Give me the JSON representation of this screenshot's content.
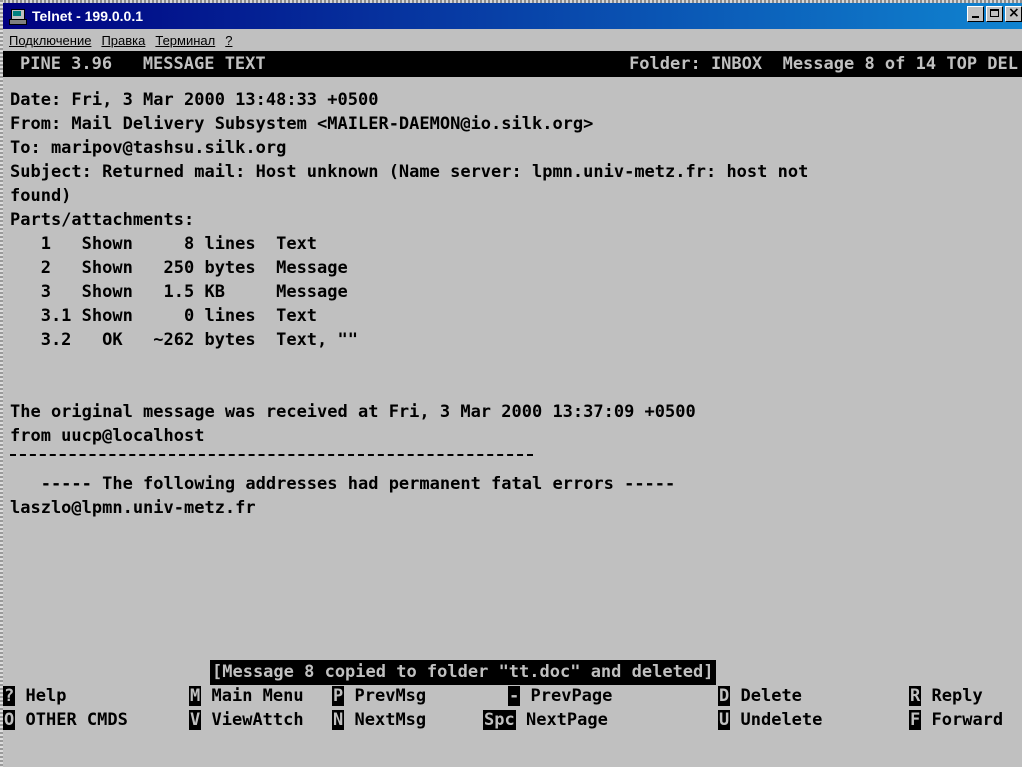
{
  "window": {
    "title": "Telnet - 199.0.0.1",
    "buttons": {
      "minimize": "_",
      "maximize": "□",
      "close": "×"
    }
  },
  "menu": {
    "items": [
      "Подключение",
      "Правка",
      "Терминал",
      "?"
    ]
  },
  "header": {
    "left": "PINE 3.96   MESSAGE TEXT",
    "right": "Folder: INBOX  Message 8 of 14 TOP DEL"
  },
  "message": {
    "lines": [
      "Date: Fri, 3 Mar 2000 13:48:33 +0500",
      "From: Mail Delivery Subsystem <MAILER-DAEMON@io.silk.org>",
      "To: maripov@tashsu.silk.org",
      "Subject: Returned mail: Host unknown (Name server: lpmn.univ-metz.fr: host not",
      "found)",
      "Parts/attachments:",
      "   1   Shown     8 lines  Text",
      "   2   Shown   250 bytes  Message",
      "   3   Shown   1.5 KB     Message",
      "   3.1 Shown     0 lines  Text",
      "   3.2   OK   ~262 bytes  Text, \"\""
    ],
    "body": [
      "The original message was received at Fri, 3 Mar 2000 13:37:09 +0500",
      "from uucp@localhost",
      "",
      "   ----- The following addresses had permanent fatal errors -----",
      "laszlo@lpmn.univ-metz.fr"
    ]
  },
  "status_message": "[Message 8 copied to folder \"tt.doc\" and deleted]",
  "commands": {
    "row1": [
      {
        "key": "?",
        "label": "Help"
      },
      {
        "key": "M",
        "label": "Main Menu"
      },
      {
        "key": "P",
        "label": "PrevMsg"
      },
      {
        "key": "-",
        "label": "PrevPage"
      },
      {
        "key": "D",
        "label": "Delete"
      },
      {
        "key": "R",
        "label": "Reply"
      }
    ],
    "row2": [
      {
        "key": "O",
        "label": "OTHER CMDS"
      },
      {
        "key": "V",
        "label": "ViewAttch"
      },
      {
        "key": "N",
        "label": "NextMsg"
      },
      {
        "key": "Spc",
        "label": "NextPage"
      },
      {
        "key": "U",
        "label": "Undelete"
      },
      {
        "key": "F",
        "label": "Forward"
      }
    ]
  },
  "colors": {
    "title_gradient_start": "#000080",
    "title_gradient_end": "#1084d0",
    "terminal_bg": "#c0c0c0",
    "terminal_fg": "#000000"
  }
}
